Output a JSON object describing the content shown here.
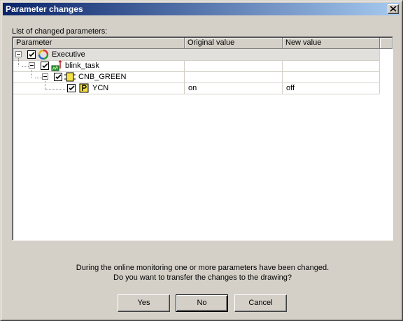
{
  "window": {
    "title": "Parameter changes"
  },
  "list_label": "List of changed parameters:",
  "columns": [
    "Parameter",
    "Original value",
    "New value"
  ],
  "tree": [
    {
      "label": "Executive",
      "original": "",
      "new": "",
      "checked": true,
      "icon": "executive-icon"
    },
    {
      "label": "blink_task",
      "original": "",
      "new": "",
      "checked": true,
      "icon": "task-icon"
    },
    {
      "label": "CNB_GREEN",
      "original": "",
      "new": "",
      "checked": true,
      "icon": "block-icon"
    },
    {
      "label": "YCN",
      "original": "on",
      "new": "off",
      "checked": true,
      "icon": "parameter-icon"
    }
  ],
  "message": {
    "line1": "During the online monitoring one or more parameters have been changed.",
    "line2": "Do you want to transfer the changes to the drawing?"
  },
  "buttons": {
    "yes": "Yes",
    "no": "No",
    "cancel": "Cancel"
  }
}
